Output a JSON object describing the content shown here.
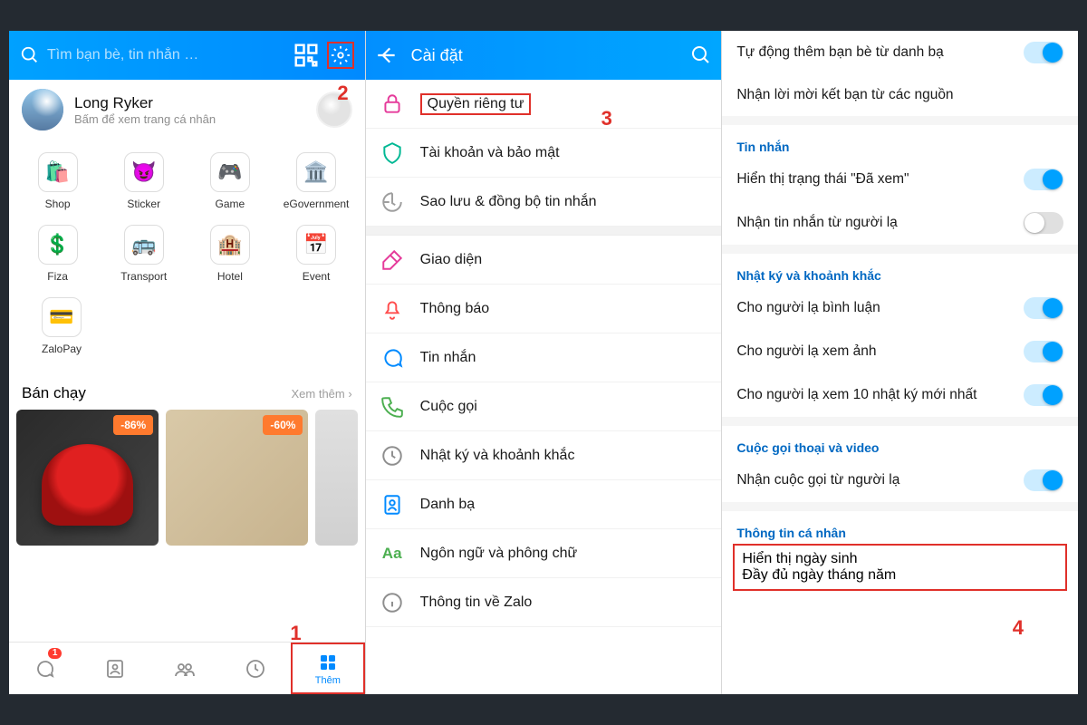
{
  "panel1": {
    "search_placeholder": "Tìm bạn bè, tin nhắn …",
    "profile_name": "Long Ryker",
    "profile_sub": "Bấm để xem trang cá nhân",
    "apps": [
      {
        "icon": "🛍️",
        "label": "Shop"
      },
      {
        "icon": "😈",
        "label": "Sticker",
        "color": "#a05ce6"
      },
      {
        "icon": "🎮",
        "label": "Game",
        "color": "#4caf50"
      },
      {
        "icon": "🏛️",
        "label": "eGovernment",
        "color": "#e53a9a"
      },
      {
        "icon": "💲",
        "label": "Fiza",
        "color": "#ffb300"
      },
      {
        "icon": "🚌",
        "label": "Transport",
        "color": "#00b894"
      },
      {
        "icon": "🏨",
        "label": "Hotel",
        "color": "#00a1ff"
      },
      {
        "icon": "📅",
        "label": "Event",
        "color": "#008aff"
      },
      {
        "icon": "💳",
        "label": "ZaloPay",
        "color": "#0068ff"
      }
    ],
    "trend_title": "Bán chạy",
    "trend_more": "Xem thêm ›",
    "discounts": [
      "-86%",
      "-60%"
    ],
    "nav": [
      {
        "label": "",
        "badge": "1"
      },
      {
        "label": ""
      },
      {
        "label": ""
      },
      {
        "label": ""
      },
      {
        "label": "Thêm",
        "active": true
      }
    ],
    "anno1": "1",
    "anno2": "2"
  },
  "panel2": {
    "title": "Cài đặt",
    "items": [
      {
        "label": "Quyền riêng tư",
        "color": "#e53a9a",
        "highlight": true
      },
      {
        "label": "Tài khoản và bảo mật",
        "color": "#00b894"
      },
      {
        "label": "Sao lưu & đồng bộ tin nhắn",
        "color": "#9e9e9e"
      }
    ],
    "items2": [
      {
        "label": "Giao diện",
        "color": "#e53a9a"
      },
      {
        "label": "Thông báo",
        "color": "#ff4d4d"
      },
      {
        "label": "Tin nhắn",
        "color": "#008aff"
      },
      {
        "label": "Cuộc gọi",
        "color": "#4caf50"
      },
      {
        "label": "Nhật ký và khoảnh khắc",
        "color": "#8e8e8e"
      },
      {
        "label": "Danh bạ",
        "color": "#008aff"
      },
      {
        "label": "Ngôn ngữ và phông chữ",
        "color": "#4caf50",
        "aa": true
      },
      {
        "label": "Thông tin về Zalo",
        "color": "#8e8e8e"
      }
    ],
    "anno": "3"
  },
  "panel3": {
    "top_items": [
      {
        "label": "Tự động thêm bạn bè từ danh bạ",
        "on": true
      },
      {
        "label": "Nhận lời mời kết bạn từ các nguồn",
        "toggle": false
      }
    ],
    "sections": [
      {
        "title": "Tin nhắn",
        "rows": [
          {
            "label": "Hiển thị trạng thái \"Đã xem\"",
            "on": true
          },
          {
            "label": "Nhận tin nhắn từ người lạ",
            "on": false
          }
        ]
      },
      {
        "title": "Nhật ký và khoảnh khắc",
        "rows": [
          {
            "label": "Cho người lạ bình luận",
            "on": true
          },
          {
            "label": "Cho người lạ xem ảnh",
            "on": true
          },
          {
            "label": "Cho người lạ xem 10 nhật ký mới nhất",
            "on": true
          }
        ]
      },
      {
        "title": "Cuộc gọi thoại và video",
        "rows": [
          {
            "label": "Nhận cuộc gọi từ người lạ",
            "on": true
          }
        ]
      },
      {
        "title": "Thông tin cá nhân",
        "rows": [
          {
            "label": "Hiển thị ngày sinh",
            "sub": "Đầy đủ ngày tháng năm",
            "highlight": true
          }
        ]
      }
    ],
    "anno": "4"
  }
}
